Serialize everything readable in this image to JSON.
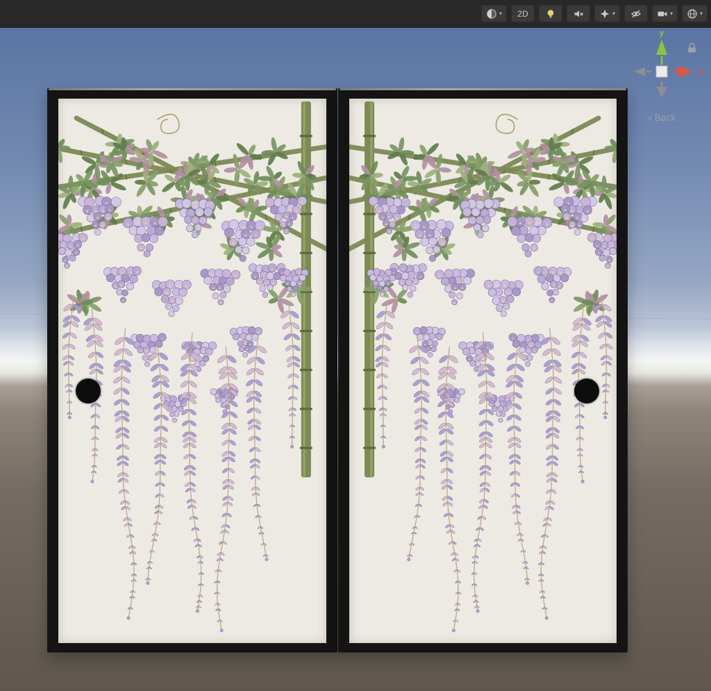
{
  "toolbar": {
    "background": "#282828",
    "caret_glyph": "▾",
    "buttons": [
      {
        "name": "shading-mode",
        "icon": "shaded-sphere-icon",
        "has_dropdown": true
      },
      {
        "name": "2d-toggle",
        "label": "2D"
      },
      {
        "name": "lighting-toggle",
        "icon": "light-bulb-icon"
      },
      {
        "name": "audio-toggle",
        "icon": "audio-muted-icon"
      },
      {
        "name": "effects-toggle",
        "icon": "effects-star-icon",
        "has_dropdown": true
      },
      {
        "name": "scene-visibility-toggle",
        "icon": "eye-hidden-icon"
      },
      {
        "name": "camera-view",
        "icon": "video-camera-icon",
        "has_dropdown": true
      },
      {
        "name": "gizmos-menu",
        "icon": "globe-icon",
        "has_dropdown": true
      }
    ]
  },
  "scene_gizmo": {
    "axis_y_label": "y",
    "axis_x_label": "x",
    "axis_y_color": "#8bc53f",
    "axis_x_color": "#e0563f",
    "neutral_cone_color": "#909090",
    "back_chevron": "<",
    "back_label": "Back",
    "lock_icon": "padlock-icon"
  },
  "scene": {
    "sky_top_color": "#5a74a3",
    "horizon_color": "#f4f6f4",
    "ground_color": "#5f574d",
    "doors": {
      "count": 2,
      "frame_color": "#141414",
      "panel_color": "#edeae3",
      "handle_color": "#0d0d0d"
    },
    "artwork": {
      "motif": "wisteria-on-bamboo-trellis",
      "bamboo": "#7d8a55",
      "bamboo_dark": "#5f6b3c",
      "bamboo_light": "#a6b378",
      "stem": "#b9a57e",
      "tendril": "#a8a070",
      "leaf_colors": [
        "#6d8c58",
        "#86a068",
        "#9db07c",
        "#5e7d4b",
        "#b08fa0",
        "#7a9464"
      ],
      "flower_fills": [
        "#b9abd6",
        "#c8bbe0",
        "#a697c8",
        "#d3c8e8",
        "#cbb3d8"
      ],
      "flower_stroke": "#7a6a9a",
      "flower_center": "#e6de8e",
      "raceme_pink": "#d6b9ca",
      "raceme_purple": "#a99dd0",
      "raceme_stroke": "#8f7fae"
    }
  }
}
